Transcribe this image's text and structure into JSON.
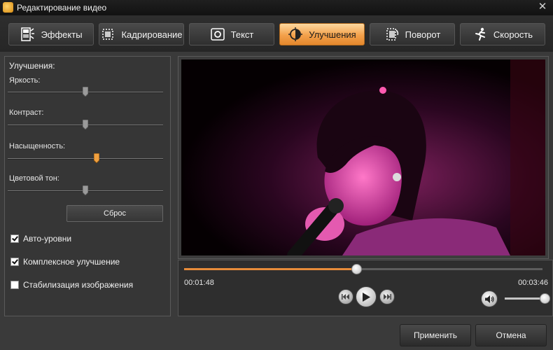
{
  "window": {
    "title": "Редактирование видео",
    "close_glyph": "✕",
    "icon": "app-icon"
  },
  "tabs": [
    {
      "label": "Эффекты",
      "icon": "effects-icon",
      "active": false
    },
    {
      "label": "Кадрирование",
      "icon": "crop-icon",
      "active": false
    },
    {
      "label": "Текст",
      "icon": "text-icon",
      "active": false
    },
    {
      "label": "Улучшения",
      "icon": "enhance-icon",
      "active": true
    },
    {
      "label": "Поворот",
      "icon": "rotate-icon",
      "active": false
    },
    {
      "label": "Скорость",
      "icon": "speed-icon",
      "active": false
    }
  ],
  "enhance_panel": {
    "title": "Улучшения:",
    "sliders": [
      {
        "label": "Яркость:",
        "value": 0.5
      },
      {
        "label": "Контраст:",
        "value": 0.5
      },
      {
        "label": "Насыщенность:",
        "value": 0.57
      },
      {
        "label": "Цветовой тон:",
        "value": 0.5
      }
    ],
    "reset_label": "Сброс",
    "checkboxes": [
      {
        "label": "Авто-уровни",
        "checked": true
      },
      {
        "label": "Комплексное улучшение",
        "checked": true
      },
      {
        "label": "Стабилизация изображения",
        "checked": false
      }
    ]
  },
  "player": {
    "current_time": "00:01:48",
    "total_time": "00:03:46",
    "progress": 0.48,
    "volume": 1.0
  },
  "footer": {
    "apply_label": "Применить",
    "cancel_label": "Отмена"
  },
  "colors": {
    "accent": "#e88c3a",
    "active_tab": "#f3a04a",
    "background": "#3a3a3a"
  }
}
